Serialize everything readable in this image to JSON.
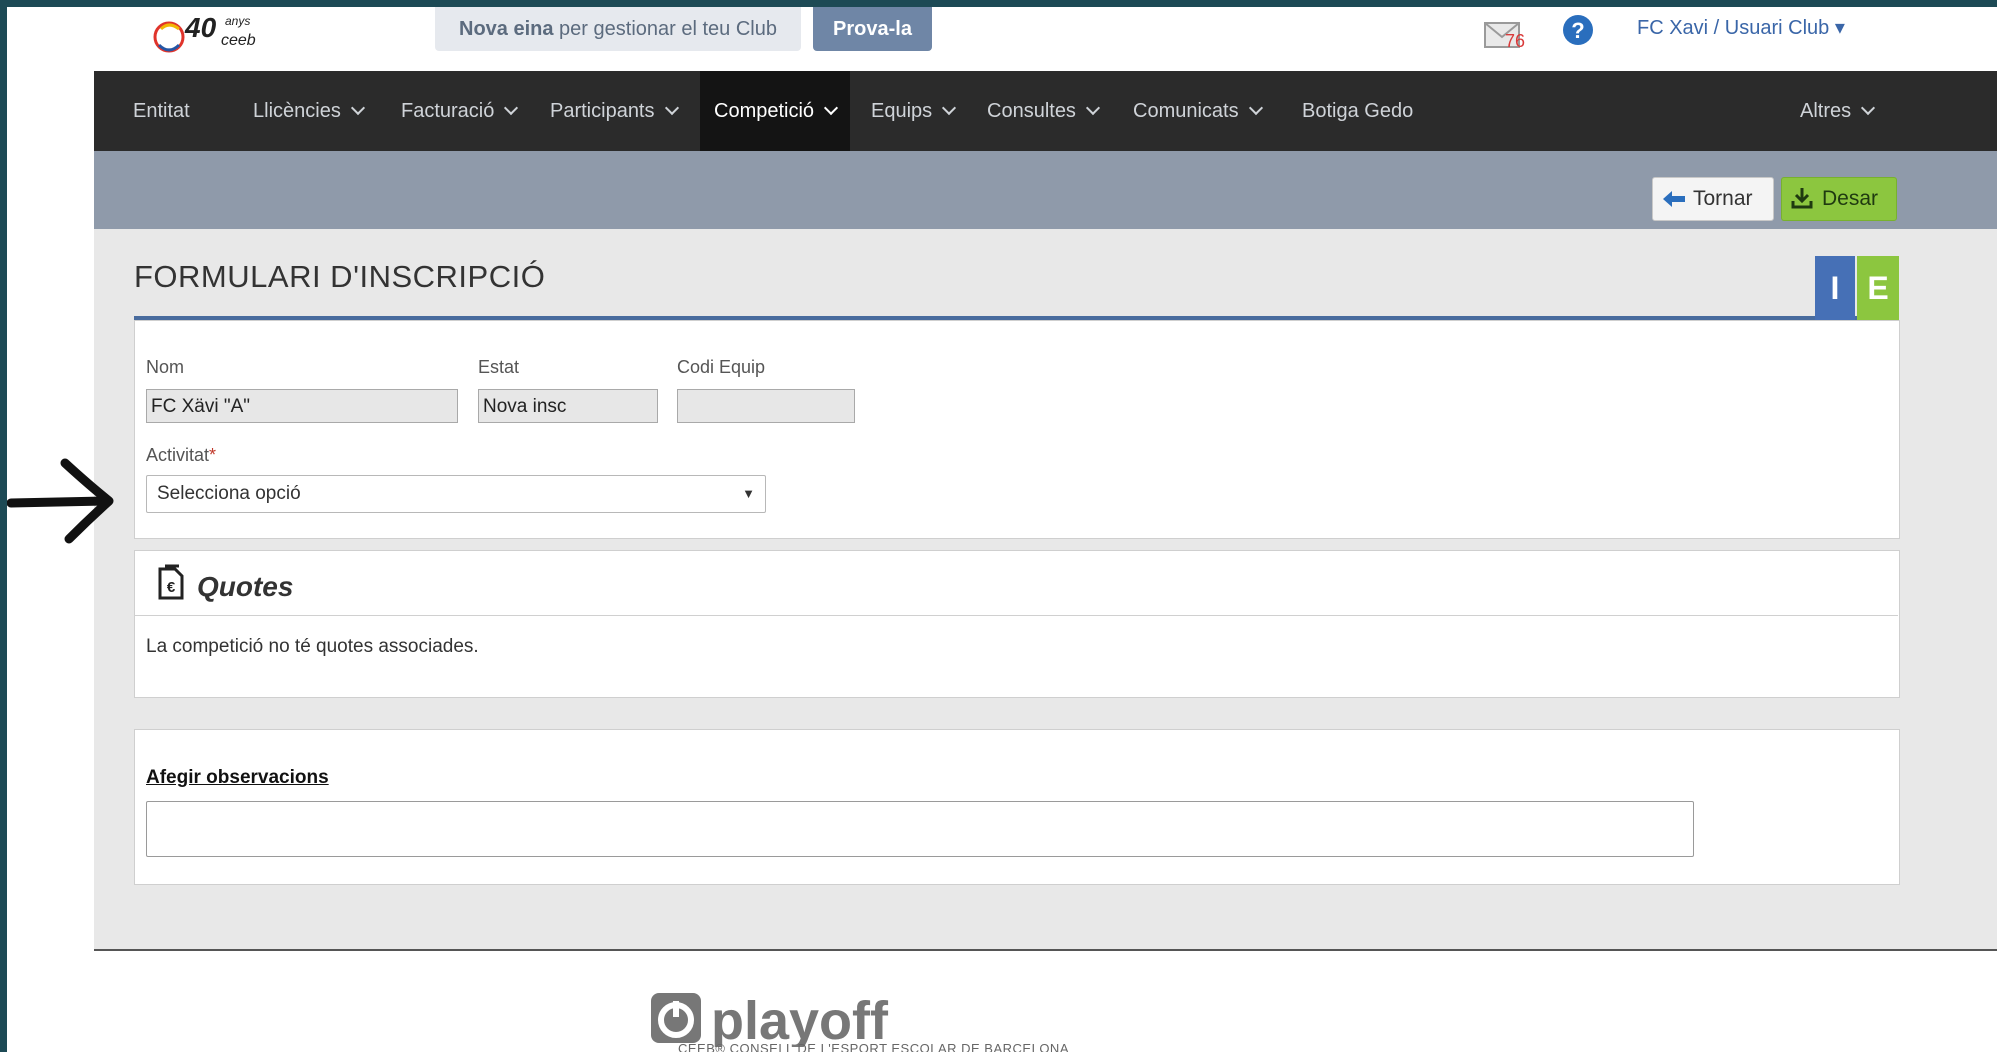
{
  "header": {
    "logo_text": "40 anys ceeb",
    "promo_bold": "Nova eina",
    "promo_rest": " per gestionar el teu Club",
    "try_button": "Prova-la",
    "mail_count": "76",
    "user_menu": "FC Xavi / Usuari Club ▾"
  },
  "nav": {
    "items": [
      {
        "label": "Entitat"
      },
      {
        "label": "Llicències"
      },
      {
        "label": "Facturació"
      },
      {
        "label": "Participants"
      },
      {
        "label": "Competició"
      },
      {
        "label": "Equips"
      },
      {
        "label": "Consultes"
      },
      {
        "label": "Comunicats"
      },
      {
        "label": "Botiga Gedo"
      },
      {
        "label": "Altres"
      }
    ],
    "active": "Competició"
  },
  "toolbar": {
    "back_label": "Tornar",
    "save_label": "Desar"
  },
  "form": {
    "title": "FORMULARI D'INSCRIPCIÓ",
    "badge_i": "I",
    "badge_e": "E",
    "fields": {
      "nom_label": "Nom",
      "nom_value": "FC Xävi \"A\"",
      "estat_label": "Estat",
      "estat_value": "Nova insc",
      "codi_label": "Codi Equip",
      "codi_value": "",
      "activitat_label": "Activitat",
      "activitat_required": "*",
      "activitat_value": "Selecciona opció"
    }
  },
  "quotes": {
    "title": "Quotes",
    "message": "La competició no té quotes associades."
  },
  "observations": {
    "link": "Afegir observacions",
    "value": ""
  },
  "footer": {
    "brand": "playoff",
    "org": "CEEB® CONSELL DE L'ESPORT ESCOLAR DE BARCELONA"
  },
  "colors": {
    "nav_bg": "#2b2b2b",
    "toolbar_bg": "#8f9aaa",
    "accent_blue": "#4670b6",
    "accent_green": "#8cc63f"
  }
}
